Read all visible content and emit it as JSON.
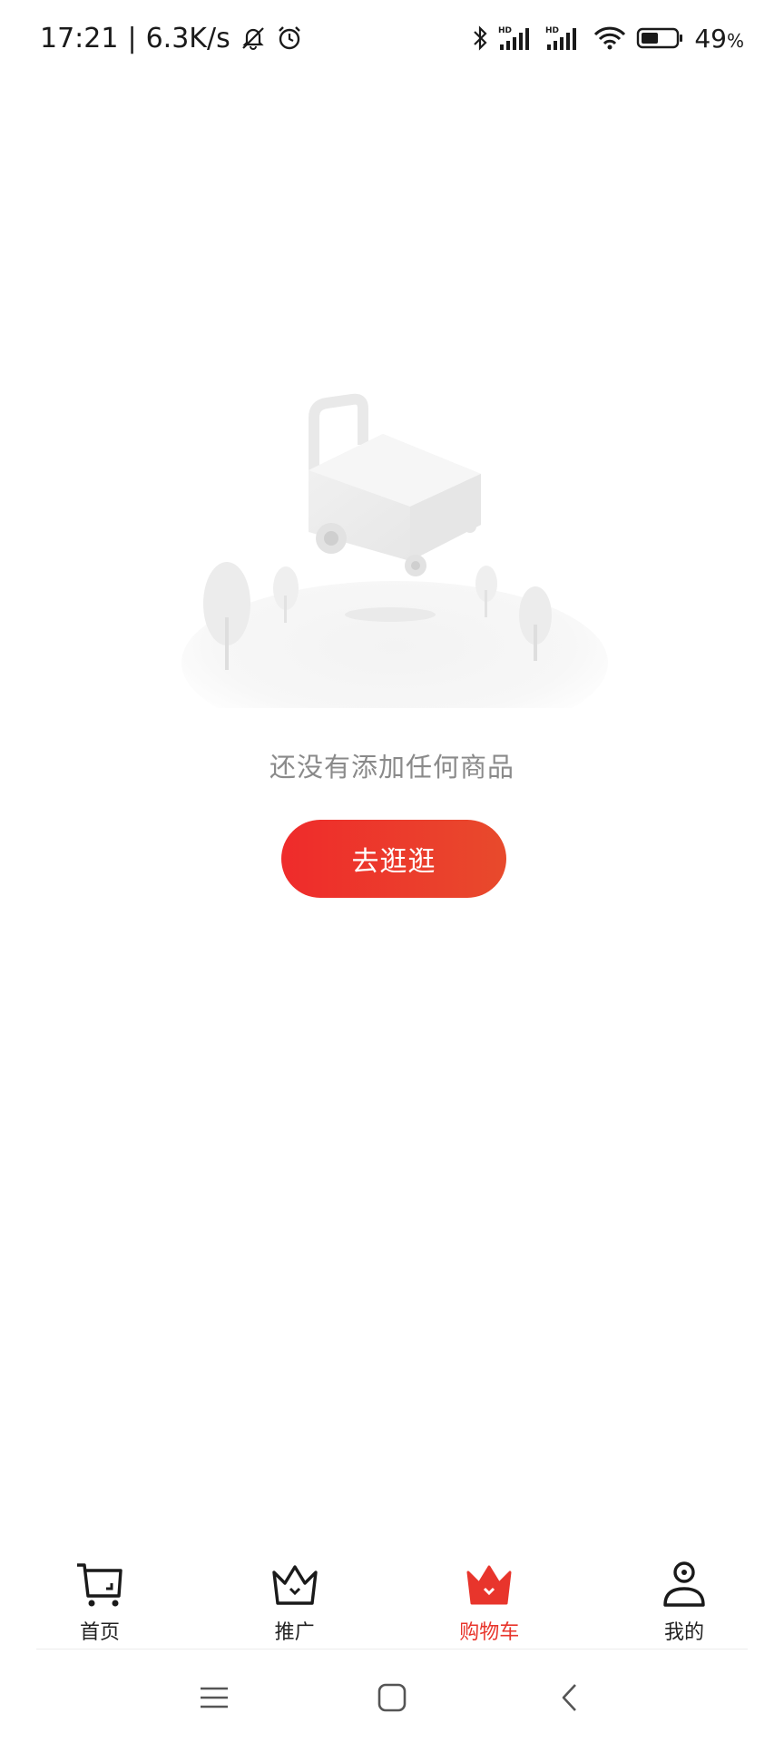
{
  "status_bar": {
    "time": "17:21",
    "separator": "|",
    "net_speed": "6.3K/s",
    "battery_value": "49",
    "battery_unit": "%",
    "signal_label_1": "HD",
    "signal_label_2": "HD",
    "icons": [
      "mute-bell-icon",
      "alarm-icon",
      "bluetooth-icon",
      "signal-hd-icon",
      "signal-hd-icon",
      "wifi-icon",
      "battery-icon"
    ]
  },
  "empty_state": {
    "message": "还没有添加任何商品",
    "button_label": "去逛逛",
    "illustration_icon": "empty-cart-illustration"
  },
  "tabs": [
    {
      "label": "首页",
      "icon": "cart-outline-icon",
      "active": false
    },
    {
      "label": "推广",
      "icon": "crown-outline-icon",
      "active": false
    },
    {
      "label": "购物车",
      "icon": "crown-filled-icon",
      "active": true
    },
    {
      "label": "我的",
      "icon": "person-icon",
      "active": false
    }
  ],
  "system_nav": {
    "icons": [
      "menu-icon",
      "home-square-icon",
      "back-chevron-icon"
    ]
  },
  "colors": {
    "accent": "#e8352c",
    "button_gradient_start": "#ef2b2b",
    "button_gradient_end": "#e84a2c",
    "muted_text": "#8a8a8a"
  }
}
